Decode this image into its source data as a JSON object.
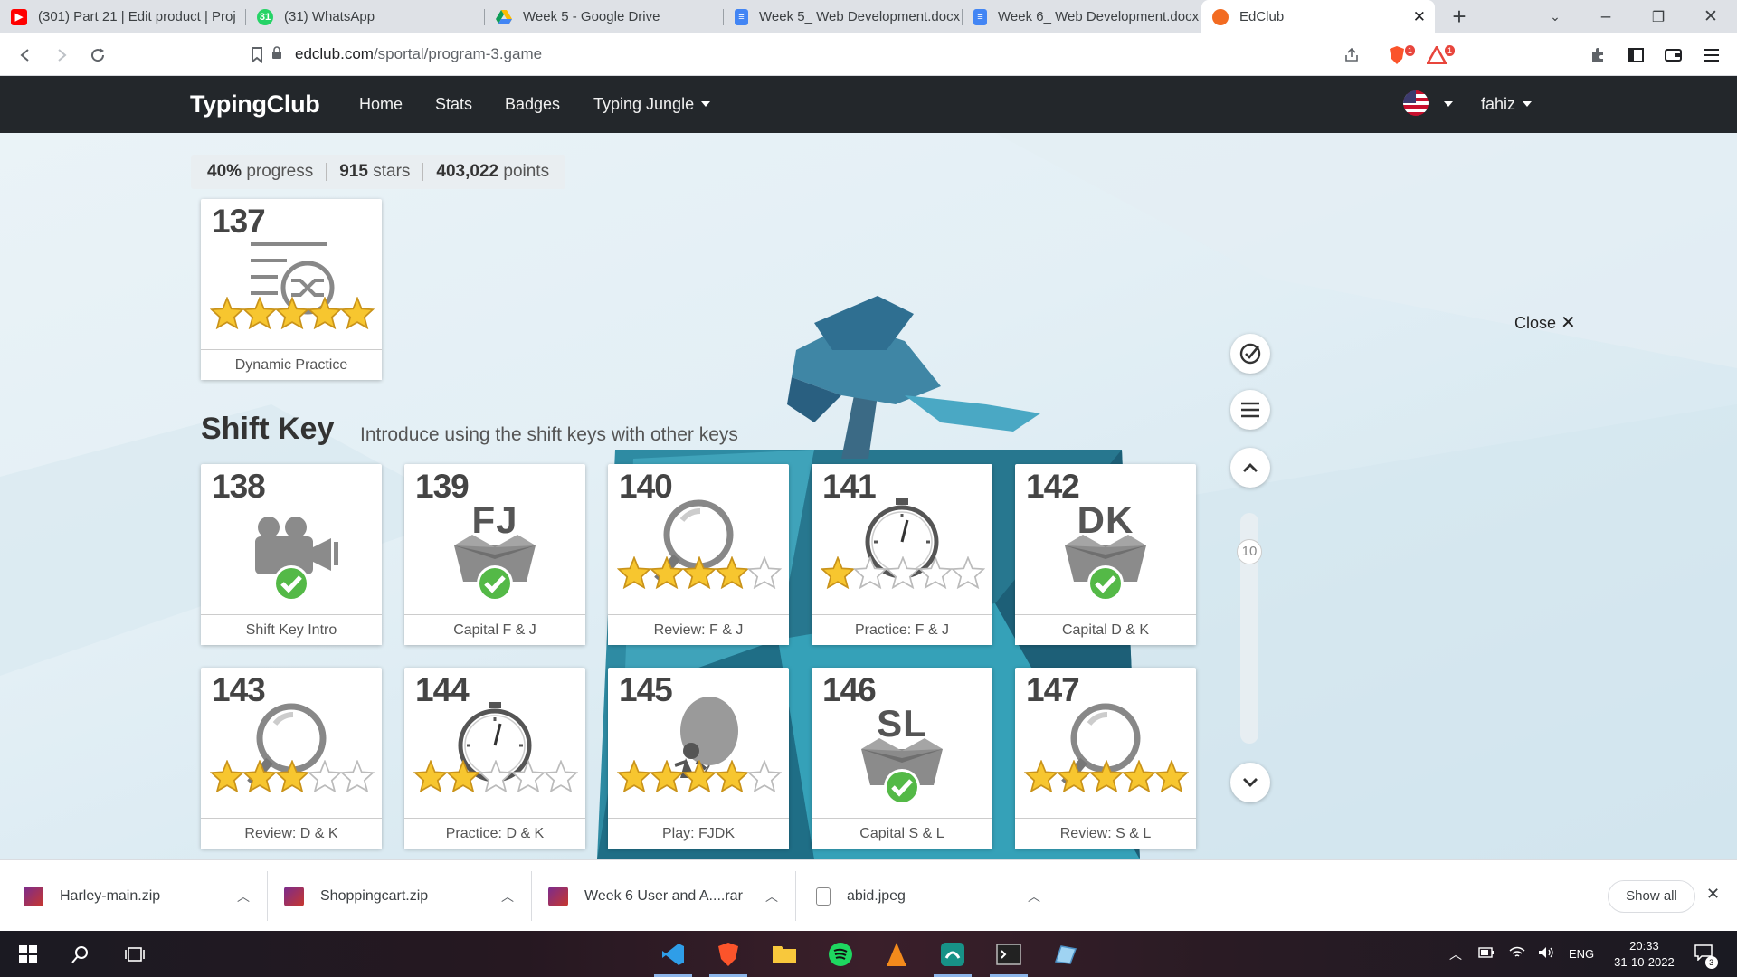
{
  "browser": {
    "tabs": [
      {
        "title": "(301) Part 21 | Edit product | Proj",
        "favicon": "youtube-icon",
        "color": "#ff0000"
      },
      {
        "title": "(31) WhatsApp",
        "favicon": "whatsapp-icon",
        "color": "#25d366",
        "badge": "31"
      },
      {
        "title": "Week 5 - Google Drive",
        "favicon": "google-drive-icon",
        "color": "#fbbc04"
      },
      {
        "title": "Week 5_ Web Development.docx",
        "favicon": "google-docs-icon",
        "color": "#4285f4"
      },
      {
        "title": "Week 6_ Web Development.docx",
        "favicon": "google-docs-icon",
        "color": "#4285f4"
      },
      {
        "title": "EdClub",
        "favicon": "edclub-icon",
        "color": "#f26b21"
      }
    ],
    "url_host": "edclub.com",
    "url_path": "/sportal/program-3.game",
    "extension_badges": [
      "1",
      "1"
    ]
  },
  "navbar": {
    "brand": "TypingClub",
    "links": [
      "Home",
      "Stats",
      "Badges",
      "Typing Jungle"
    ],
    "user": "fahiz"
  },
  "stats": {
    "progress_value": "40%",
    "progress_label": "progress",
    "stars_value": "915",
    "stars_label": "stars",
    "points_value": "403,022",
    "points_label": "points"
  },
  "lessons_top": [
    {
      "number": "137",
      "caption": "Dynamic Practice",
      "icon": "shuffle-icon",
      "stars": 5
    }
  ],
  "section": {
    "title": "Shift Key",
    "subtitle": "Introduce using the shift keys with other keys"
  },
  "lessons": [
    {
      "number": "138",
      "caption": "Shift Key Intro",
      "icon": "video-camera-icon",
      "completed": true
    },
    {
      "number": "139",
      "caption": "Capital F & J",
      "icon": "box-icon",
      "keys": "FJ",
      "completed": true
    },
    {
      "number": "140",
      "caption": "Review: F & J",
      "icon": "magnifier-icon",
      "stars": 4
    },
    {
      "number": "141",
      "caption": "Practice: F & J",
      "icon": "stopwatch-icon",
      "stars": 1
    },
    {
      "number": "142",
      "caption": "Capital D & K",
      "icon": "box-icon",
      "keys": "DK",
      "completed": true
    },
    {
      "number": "143",
      "caption": "Review: D & K",
      "icon": "magnifier-icon",
      "stars": 3
    },
    {
      "number": "144",
      "caption": "Practice: D & K",
      "icon": "stopwatch-icon",
      "stars": 2
    },
    {
      "number": "145",
      "caption": "Play: FJDK",
      "icon": "balloon-icon",
      "stars": 4
    },
    {
      "number": "146",
      "caption": "Capital S & L",
      "icon": "box-icon",
      "keys": "SL",
      "completed": true
    },
    {
      "number": "147",
      "caption": "Review: S & L",
      "icon": "magnifier-icon",
      "stars": 5
    }
  ],
  "side_controls": {
    "close_label": "Close",
    "scroll_value": "10"
  },
  "downloads": {
    "items": [
      "Harley-main.zip",
      "Shoppingcart.zip",
      "Week 6 User and A....rar",
      "abid.jpeg"
    ],
    "show_all": "Show all"
  },
  "taskbar": {
    "language": "ENG",
    "time": "20:33",
    "date": "31-10-2022",
    "notification_count": "3"
  }
}
